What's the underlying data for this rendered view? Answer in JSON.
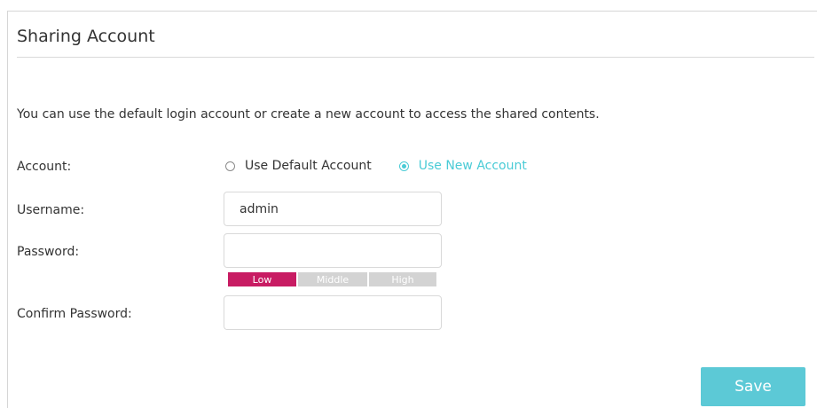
{
  "section": {
    "title": "Sharing Account",
    "description": "You can use the default login account or create a new account to access the shared contents."
  },
  "account": {
    "label": "Account:",
    "options": [
      {
        "label": "Use Default Account",
        "selected": false
      },
      {
        "label": "Use New Account",
        "selected": true
      }
    ]
  },
  "username": {
    "label": "Username:",
    "value": "admin"
  },
  "password": {
    "label": "Password:",
    "value": "",
    "strength": {
      "levels": [
        "Low",
        "Middle",
        "High"
      ],
      "active": "Low"
    }
  },
  "confirm_password": {
    "label": "Confirm Password:",
    "value": ""
  },
  "save_label": "Save",
  "colors": {
    "accent": "#4acbd6",
    "save_button": "#5cc9d6",
    "strength_low": "#c81c63",
    "strength_inactive": "#d3d3d3"
  }
}
